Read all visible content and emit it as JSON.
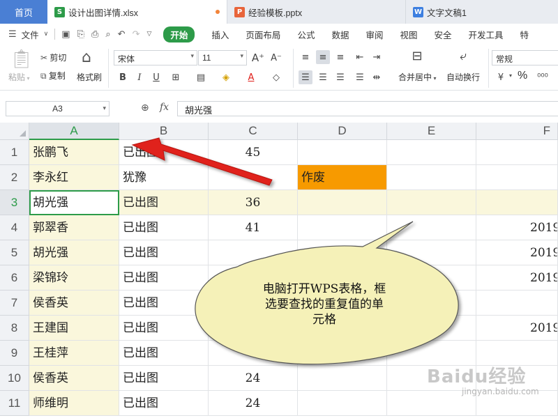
{
  "tabs": {
    "home": "首页",
    "items": [
      {
        "label": "设计出图详情.xlsx",
        "icon_text": "S",
        "color": "#2d9b49",
        "active": true
      },
      {
        "label": "经验模板.pptx",
        "icon_text": "P",
        "color": "#e8643a",
        "active": false
      },
      {
        "label": "文字文稿1",
        "icon_text": "W",
        "color": "#3d7fe0",
        "active": false
      }
    ]
  },
  "menubar": {
    "file": "文件",
    "start": "开始",
    "items": [
      "插入",
      "页面布局",
      "公式",
      "数据",
      "审阅",
      "视图",
      "安全",
      "开发工具",
      "特"
    ]
  },
  "ribbon": {
    "paste": "粘贴",
    "cut": "剪切",
    "copy": "复制",
    "format_painter": "格式刷",
    "font_name": "宋体",
    "font_size": "11",
    "merge_center": "合并居中",
    "wrap_text": "自动换行",
    "number_format": "常规",
    "percent": "%"
  },
  "formula_bar": {
    "cell_ref": "A3",
    "fx": "fx",
    "value": "胡光强"
  },
  "columns": [
    "A",
    "B",
    "C",
    "D",
    "E",
    "F"
  ],
  "rows": [
    {
      "num": "1",
      "a": "张鹏飞",
      "b": "已出图",
      "c": "45",
      "d": "",
      "f": ""
    },
    {
      "num": "2",
      "a": "李永红",
      "b": "犹豫",
      "c": "",
      "d": "作废",
      "f": ""
    },
    {
      "num": "3",
      "a": "胡光强",
      "b": "已出图",
      "c": "36",
      "d": "",
      "f": ""
    },
    {
      "num": "4",
      "a": "郭翠香",
      "b": "已出图",
      "c": "41",
      "d": "",
      "f": "2019"
    },
    {
      "num": "5",
      "a": "胡光强",
      "b": "已出图",
      "c": "",
      "d": "",
      "f": "2019"
    },
    {
      "num": "6",
      "a": "梁锦玲",
      "b": "已出图",
      "c": "",
      "d": "",
      "f": "2019"
    },
    {
      "num": "7",
      "a": "侯香英",
      "b": "已出图",
      "c": "",
      "d": "",
      "f": ""
    },
    {
      "num": "8",
      "a": "王建国",
      "b": "已出图",
      "c": "",
      "d": "",
      "f": "2019"
    },
    {
      "num": "9",
      "a": "王桂萍",
      "b": "已出图",
      "c": "",
      "d": "",
      "f": ""
    },
    {
      "num": "10",
      "a": "侯香英",
      "b": "已出图",
      "c": "24",
      "d": "",
      "f": ""
    },
    {
      "num": "11",
      "a": "师维明",
      "b": "已出图",
      "c": "24",
      "d": "",
      "f": ""
    }
  ],
  "annotation": {
    "bubble_line1": "电脑打开WPS表格，框",
    "bubble_line2": "选要查找的重复值的单",
    "bubble_line3": "元格"
  },
  "watermark": {
    "main": "Baidu经验",
    "sub": "jingyan.baidu.com"
  },
  "colors": {
    "accent_green": "#2d9b49",
    "highlight_orange": "#f79a00",
    "selection_yellow": "#faf7dc",
    "arrow_red": "#e0201b",
    "bubble_fill": "#f5f1b8"
  }
}
